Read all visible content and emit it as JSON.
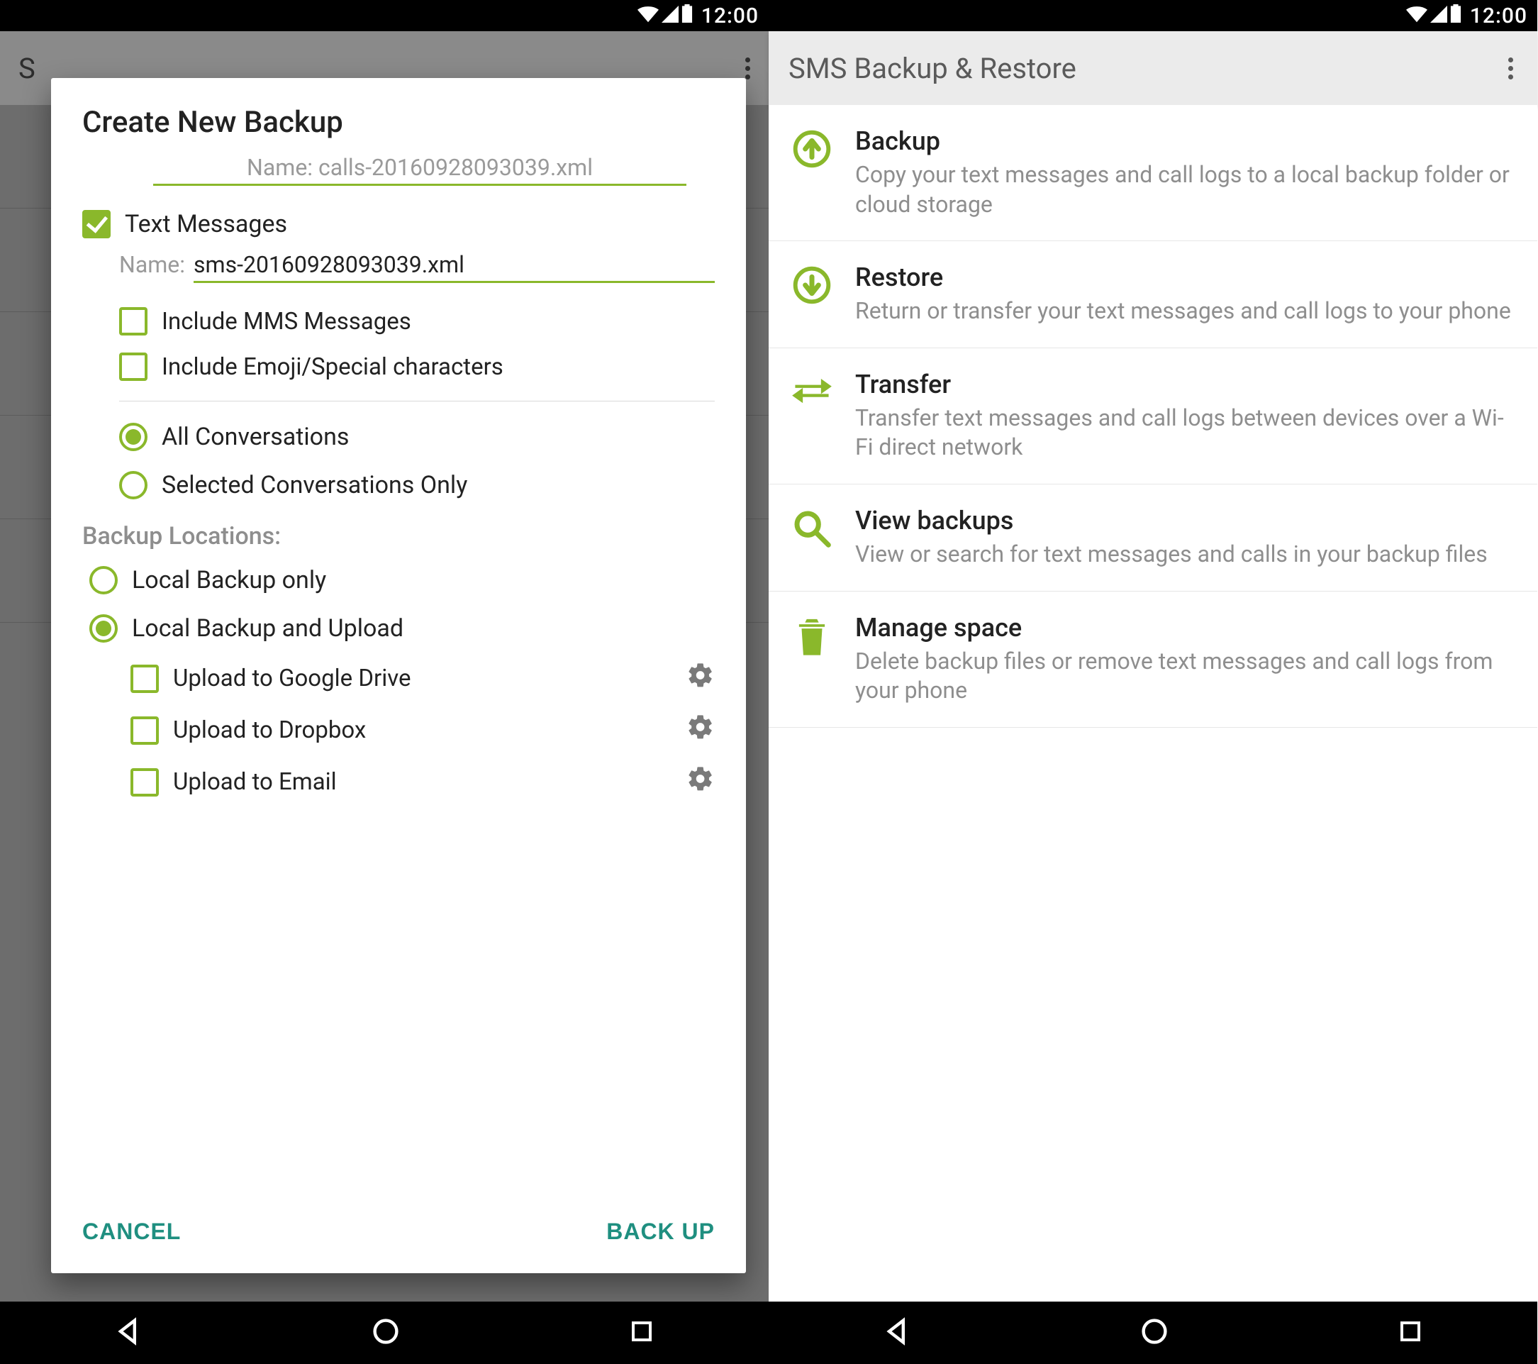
{
  "status": {
    "time": "12:00"
  },
  "dialog": {
    "title": "Create New Backup",
    "truncated_name_row": "Name: calls-20160928093039.xml",
    "text_messages_label": "Text Messages",
    "name_label": "Name:",
    "sms_filename": "sms-20160928093039.xml",
    "include_mms": "Include MMS Messages",
    "include_emoji": "Include Emoji/Special characters",
    "conv_all": "All Conversations",
    "conv_selected": "Selected Conversations Only",
    "locations_label": "Backup Locations:",
    "loc_local_only": "Local Backup only",
    "loc_local_upload": "Local Backup and Upload",
    "upload_gdrive": "Upload to Google Drive",
    "upload_dropbox": "Upload to Dropbox",
    "upload_email": "Upload to Email",
    "cancel": "CANCEL",
    "backup": "BACK UP"
  },
  "screen2": {
    "title": "SMS Backup & Restore",
    "items": [
      {
        "title": "Backup",
        "desc": "Copy your text messages and call logs to a local backup folder or cloud storage"
      },
      {
        "title": "Restore",
        "desc": "Return or transfer your text messages and call logs to your phone"
      },
      {
        "title": "Transfer",
        "desc": "Transfer text messages and call logs between devices over a Wi-Fi direct network"
      },
      {
        "title": "View backups",
        "desc": "View or search for text messages and calls in your backup files"
      },
      {
        "title": "Manage space",
        "desc": "Delete backup files or remove text messages and call logs from your phone"
      }
    ]
  },
  "bg_stub_title": "S"
}
